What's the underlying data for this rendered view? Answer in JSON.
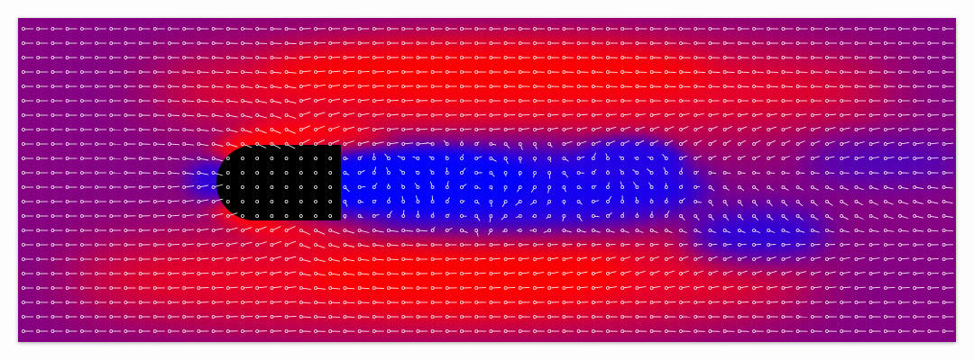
{
  "visualization": {
    "kind": "flow-field",
    "glyph": "arrow-vector",
    "colormap": {
      "low": "#0000ff",
      "mid": "#800080",
      "high": "#ff0000"
    },
    "obstacle_color": "#000000",
    "vector_color": "#ffffff"
  }
}
